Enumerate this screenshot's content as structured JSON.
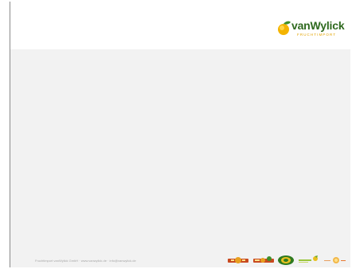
{
  "logo": {
    "word": "vanWylick",
    "sub": "FRUCHTIMPORT",
    "colors": {
      "word": "#2f6a1f",
      "sub": "#e2a300",
      "mark_fruit": "#f4b400",
      "mark_leaf": "#3f8f2a"
    }
  },
  "footer": {
    "text": "Fruchtimport vanWylick GmbH · www.vanwylick.de · info@vanwylick.de",
    "brand_logos": [
      "brand-logo-1-icon",
      "brand-logo-2-icon",
      "brand-logo-3-icon",
      "brand-logo-4-icon",
      "brand-logo-5-icon"
    ]
  },
  "colors": {
    "background": "#f2f2f2",
    "header": "#ffffff",
    "border": "#8a8a8a"
  }
}
